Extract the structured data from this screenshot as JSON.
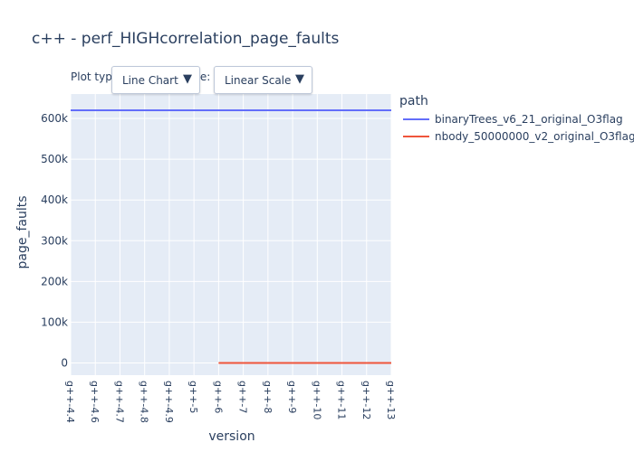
{
  "chart_data": {
    "type": "line",
    "title": "c++ - perf_HIGHcorrelation_page_faults",
    "xlabel": "version",
    "ylabel": "page_faults",
    "categories": [
      "g++-4.4",
      "g++-4.6",
      "g++-4.7",
      "g++-4.8",
      "g++-4.9",
      "g++-5",
      "g++-6",
      "g++-7",
      "g++-8",
      "g++-9",
      "g++-10",
      "g++-11",
      "g++-12",
      "g++-13"
    ],
    "ylim": [
      -30000,
      660000
    ],
    "y_ticks": [
      0,
      100000,
      200000,
      300000,
      400000,
      500000,
      600000
    ],
    "y_tick_labels": [
      "0",
      "100k",
      "200k",
      "300k",
      "400k",
      "500k",
      "600k"
    ],
    "grid": true,
    "legend_title": "path",
    "legend_placement": "right",
    "series": [
      {
        "name": "binaryTrees_v6_21_original_O3flag",
        "color": "#636efa",
        "values": [
          620000,
          620000,
          620000,
          620000,
          620000,
          620000,
          620000,
          620000,
          620000,
          620000,
          620000,
          620000,
          620000,
          620000
        ]
      },
      {
        "name": "nbody_50000000_v2_original_O3flag",
        "color": "#ef553b",
        "values": [
          null,
          null,
          null,
          null,
          null,
          null,
          0,
          0,
          0,
          0,
          0,
          0,
          0,
          0
        ]
      }
    ]
  },
  "controls": {
    "plot_type_label": "Plot type:",
    "plot_type_value": "Line Chart",
    "scale_label": "Scale:",
    "scale_value": "Linear Scale",
    "arrow": "▼"
  },
  "colors": {
    "plot_bg": "#e5ecf6",
    "grid": "#ffffff",
    "text": "#2a3f5f"
  }
}
